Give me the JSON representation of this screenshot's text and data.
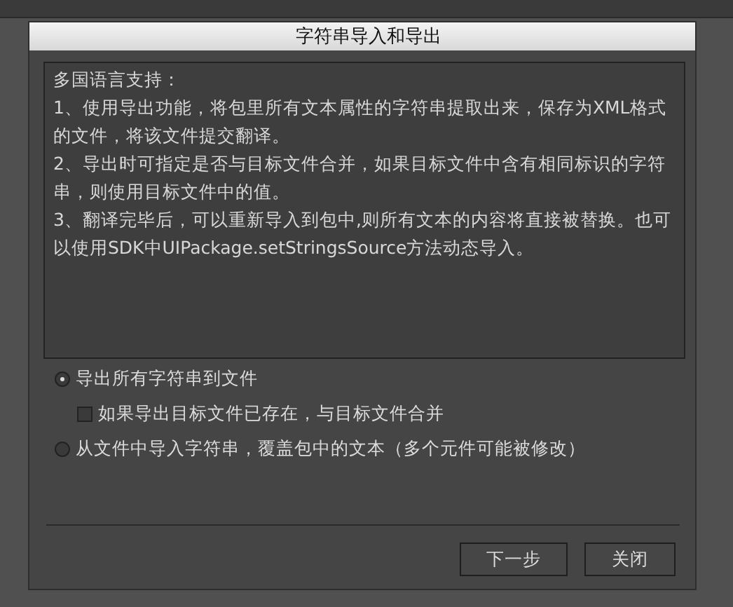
{
  "dialog": {
    "title": "字符串导入和导出"
  },
  "info": {
    "heading": "多国语言支持：",
    "paragraphs": [
      "1、使用导出功能，将包里所有文本属性的字符串提取出来，保存为XML格式的文件，将该文件提交翻译。",
      "2、导出时可指定是否与目标文件合并，如果目标文件中含有相同标识的字符串，则使用目标文件中的值。",
      "3、翻译完毕后，可以重新导入到包中,则所有文本的内容将直接被替换。也可以使用SDK中UIPackage.setStringsSource方法动态导入。"
    ]
  },
  "options": [
    {
      "kind": "radio",
      "label": "导出所有字符串到文件",
      "selected": true
    },
    {
      "kind": "checkbox",
      "label": "如果导出目标文件已存在，与目标文件合并",
      "checked": false
    },
    {
      "kind": "radio",
      "label": "从文件中导入字符串，覆盖包中的文本（多个元件可能被修改）",
      "selected": false
    }
  ],
  "buttons": [
    "下一步",
    "关闭"
  ]
}
